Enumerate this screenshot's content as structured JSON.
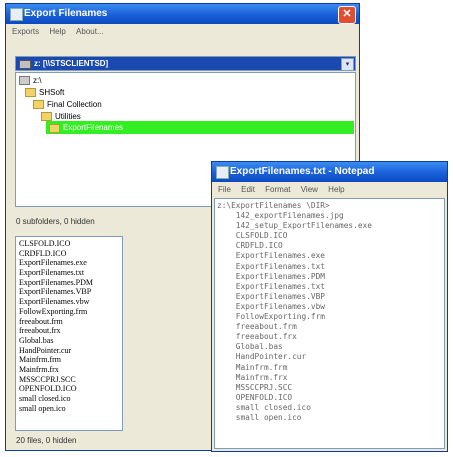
{
  "main_window": {
    "title": "Export Filenames",
    "menu": [
      "Exports",
      "Help",
      "About..."
    ],
    "drive_select": "z: [\\\\STSCLIENTSD]",
    "tree": [
      {
        "label": "z:\\",
        "level": 0,
        "selected": false
      },
      {
        "label": "SHSoft",
        "level": 1,
        "selected": false
      },
      {
        "label": "Final Collection",
        "level": 2,
        "selected": false
      },
      {
        "label": "Utilities",
        "level": 3,
        "selected": false
      },
      {
        "label": "ExportFilenames",
        "level": 4,
        "selected": true
      }
    ],
    "folder_status": "0 subfolders, 0 hidden",
    "files": [
      "CLSFOLD.ICO",
      "CRDFLD.ICO",
      "ExportFilenames.exe",
      "ExportFilenames.txt",
      "ExportFilenames.PDM",
      "ExportFilenames.VBP",
      "ExportFilenames.vbw",
      "FollowExporting.frm",
      "freeabout.frm",
      "freeabout.frx",
      "Global.bas",
      "HandPointer.cur",
      "Mainfrm.frm",
      "Mainfrm.frx",
      "MSSCCPRJ.SCC",
      "OPENFOLD.ICO",
      "small closed.ico",
      "small open.ico"
    ],
    "file_status": "20 files, 0 hidden"
  },
  "notepad": {
    "title": "ExportFilenames.txt - Notepad",
    "menu": [
      "File",
      "Edit",
      "Format",
      "View",
      "Help"
    ],
    "lines": [
      "z:\\ExportFilenames \\DIR>",
      "    142_exportFilenames.jpg",
      "    142_setup_ExportFilenames.exe",
      "    CLSFOLD.ICO",
      "    CRDFLD.ICO",
      "    ExportFilenames.exe",
      "    ExportFilenames.txt",
      "    ExportFilenames.PDM",
      "    ExportFilenames.txt",
      "    ExportFilenames.VBP",
      "    ExportFilenames.vbw",
      "    FollowExporting.frm",
      "    freeabout.frm",
      "    freeabout.frx",
      "    Global.bas",
      "    HandPointer.cur",
      "    Mainfrm.frm",
      "    Mainfrm.frx",
      "    MSSCCPRJ.SCC",
      "    OPENFOLD.ICO",
      "    small closed.ico",
      "    small open.ico"
    ]
  },
  "colors": {
    "title_blue": "#1a5fd8",
    "selection_green": "#33ee22",
    "window_bg": "#ece9d8"
  }
}
